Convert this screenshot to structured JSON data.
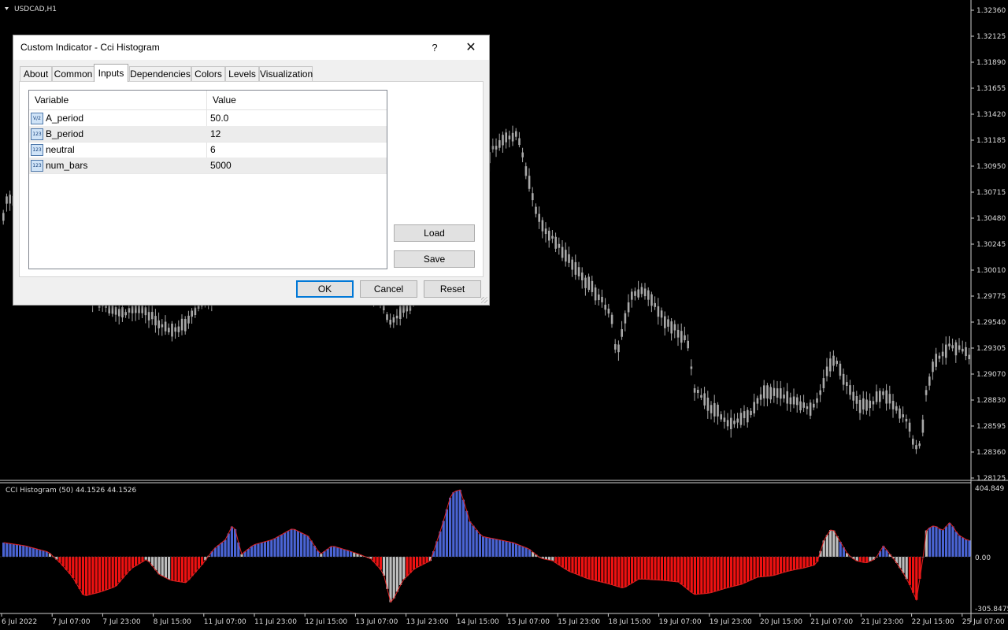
{
  "chart": {
    "symbol_label": "USDCAD,H1",
    "price_labels": [
      "1.32360",
      "1.32125",
      "1.31890",
      "1.31655",
      "1.31420",
      "1.31185",
      "1.30950",
      "1.30715",
      "1.30480",
      "1.30245",
      "1.30010",
      "1.29775",
      "1.29540",
      "1.29305",
      "1.29070",
      "1.28830",
      "1.28595",
      "1.28360",
      "1.28125"
    ],
    "indicator_label": "CCI Histogram (50) 44.1526 44.1526",
    "indicator_scale": [
      "404.849",
      "0.00",
      "-305.8475"
    ],
    "time_labels": [
      "6 Jul 2022",
      "7 Jul 07:00",
      "7 Jul 23:00",
      "8 Jul 15:00",
      "11 Jul 07:00",
      "11 Jul 23:00",
      "12 Jul 15:00",
      "13 Jul 07:00",
      "13 Jul 23:00",
      "14 Jul 15:00",
      "15 Jul 07:00",
      "15 Jul 23:00",
      "18 Jul 15:00",
      "19 Jul 07:00",
      "19 Jul 23:00",
      "20 Jul 15:00",
      "21 Jul 07:00",
      "21 Jul 23:00",
      "22 Jul 15:00",
      "25 Jul 07:00"
    ],
    "colors": {
      "background": "#000000",
      "candle": "#a9a9a9",
      "hist_positive": "#4a64d4",
      "hist_negative": "#ee1111",
      "hist_neutral": "#bdbdbd",
      "cci_line": "#dd2222"
    }
  },
  "dialog": {
    "title": "Custom Indicator - Cci Histogram",
    "help": "?",
    "close": "✕",
    "tabs": [
      "About",
      "Common",
      "Inputs",
      "Dependencies",
      "Colors",
      "Levels",
      "Visualization"
    ],
    "active_tab": "Inputs",
    "grid": {
      "col_variable": "Variable",
      "col_value": "Value",
      "rows": [
        {
          "icon": "V/2",
          "name": "A_period",
          "value": "50.0"
        },
        {
          "icon": "123",
          "name": "B_period",
          "value": "12"
        },
        {
          "icon": "123",
          "name": "neutral",
          "value": "6"
        },
        {
          "icon": "123",
          "name": "num_bars",
          "value": "5000"
        }
      ]
    },
    "buttons": {
      "load": "Load",
      "save": "Save",
      "ok": "OK",
      "cancel": "Cancel",
      "reset": "Reset"
    }
  }
}
